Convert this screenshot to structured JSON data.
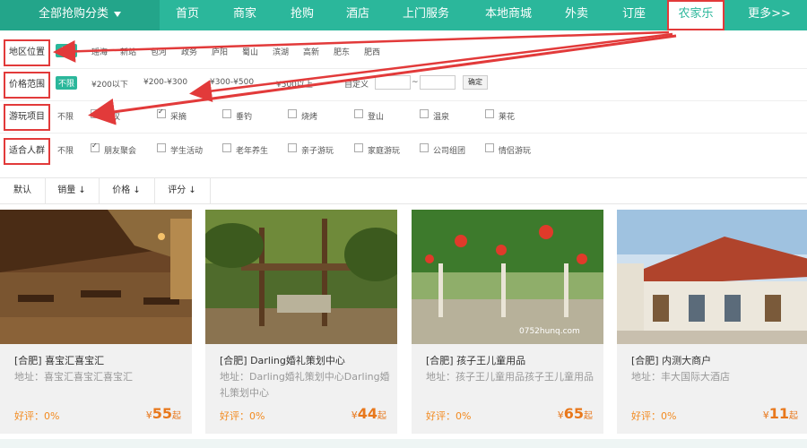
{
  "nav": {
    "category_label": "全部抢购分类",
    "items": [
      {
        "label": "首页"
      },
      {
        "label": "商家"
      },
      {
        "label": "抢购"
      },
      {
        "label": "酒店"
      },
      {
        "label": "上门服务"
      },
      {
        "label": "本地商城"
      },
      {
        "label": "外卖"
      },
      {
        "label": "订座"
      },
      {
        "label": "农家乐"
      },
      {
        "label": "更多>>"
      }
    ],
    "active_index": 8
  },
  "filters": {
    "region": {
      "label": "地区位置",
      "options": [
        "全部",
        "瑶海",
        "新站",
        "包河",
        "政务",
        "庐阳",
        "蜀山",
        "滨湖",
        "高新",
        "肥东",
        "肥西"
      ]
    },
    "price": {
      "label": "价格范围",
      "options": [
        "不限",
        "¥200以下",
        "¥200-¥300",
        "¥300-¥500",
        "¥500以上"
      ],
      "custom_label": "自定义",
      "tilde": "~",
      "confirm": "确定"
    },
    "play": {
      "label": "游玩项目",
      "none": "不限",
      "options": [
        {
          "text": "会议",
          "checked": false
        },
        {
          "text": "采摘",
          "checked": true
        },
        {
          "text": "垂钓",
          "checked": false
        },
        {
          "text": "烧烤",
          "checked": false
        },
        {
          "text": "登山",
          "checked": false
        },
        {
          "text": "温泉",
          "checked": false
        },
        {
          "text": "莱花",
          "checked": false
        }
      ]
    },
    "crowd": {
      "label": "适合人群",
      "none": "不限",
      "options": [
        {
          "text": "朋友聚会",
          "checked": true
        },
        {
          "text": "学生活动",
          "checked": false
        },
        {
          "text": "老年养生",
          "checked": false
        },
        {
          "text": "亲子游玩",
          "checked": false
        },
        {
          "text": "家庭游玩",
          "checked": false
        },
        {
          "text": "公司组团",
          "checked": false
        },
        {
          "text": "情侣游玩",
          "checked": false
        }
      ]
    }
  },
  "sort": {
    "items": [
      "默认",
      "销量 ↓",
      "价格 ↓",
      "评分 ↓"
    ]
  },
  "cards": [
    {
      "title": "[合肥] 喜宝汇喜宝汇",
      "addr": "地址：喜宝汇喜宝汇喜宝汇",
      "rating": "好评：0%",
      "currency": "¥",
      "price": "55",
      "unit": "起"
    },
    {
      "title": "[合肥] Darling婚礼策划中心",
      "addr": "地址：Darling婚礼策划中心Darling婚礼策划中心",
      "rating": "好评：0%",
      "currency": "¥",
      "price": "44",
      "unit": "起"
    },
    {
      "title": "[合肥] 孩子王儿童用品",
      "addr": "地址：孩子王儿童用品孩子王儿童用品",
      "rating": "好评：0%",
      "currency": "¥",
      "price": "65",
      "unit": "起"
    },
    {
      "title": "[合肥] 内测大商户",
      "addr": "地址：丰大国际大酒店",
      "rating": "好评：0%",
      "currency": "¥",
      "price": "11",
      "unit": "起"
    }
  ],
  "watermark": "0752hunq.com",
  "colors": {
    "brand": "#2bb79b",
    "highlight": "#e23a3a",
    "price": "#e8781c"
  }
}
